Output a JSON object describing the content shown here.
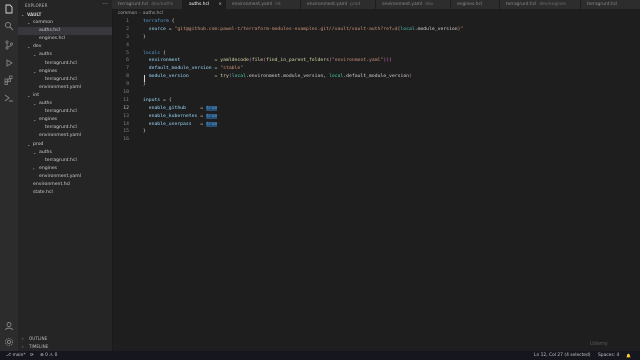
{
  "sidebar": {
    "title": "EXPLORER",
    "more": "···",
    "tree": [
      {
        "label": "VAULT",
        "indent": 0,
        "chevron": "⌄",
        "bold": true
      },
      {
        "label": "common",
        "indent": 1,
        "chevron": "⌄"
      },
      {
        "label": "auths.hcl",
        "indent": 2,
        "chevron": "",
        "selected": true
      },
      {
        "label": "engines.hcl",
        "indent": 2,
        "chevron": ""
      },
      {
        "label": "dev",
        "indent": 1,
        "chevron": "⌄"
      },
      {
        "label": "auths",
        "indent": 2,
        "chevron": "⌄"
      },
      {
        "label": "terragrunt.hcl",
        "indent": 3,
        "chevron": ""
      },
      {
        "label": "engines",
        "indent": 2,
        "chevron": "⌄"
      },
      {
        "label": "terragrunt.hcl",
        "indent": 3,
        "chevron": ""
      },
      {
        "label": "environment.yaml",
        "indent": 2,
        "chevron": ""
      },
      {
        "label": "int",
        "indent": 1,
        "chevron": "⌄"
      },
      {
        "label": "auths",
        "indent": 2,
        "chevron": "⌄"
      },
      {
        "label": "terragrunt.hcl",
        "indent": 3,
        "chevron": ""
      },
      {
        "label": "engines",
        "indent": 2,
        "chevron": "⌄"
      },
      {
        "label": "terragrunt.hcl",
        "indent": 3,
        "chevron": ""
      },
      {
        "label": "environment.yaml",
        "indent": 2,
        "chevron": ""
      },
      {
        "label": "prod",
        "indent": 1,
        "chevron": "⌄"
      },
      {
        "label": "auths",
        "indent": 2,
        "chevron": "⌄"
      },
      {
        "label": "terragrunt.hcl",
        "indent": 3,
        "chevron": ""
      },
      {
        "label": "engines",
        "indent": 2,
        "chevron": "›"
      },
      {
        "label": "environment.yaml",
        "indent": 2,
        "chevron": ""
      },
      {
        "label": "environment.hcl",
        "indent": 1,
        "chevron": ""
      },
      {
        "label": "state.hcl",
        "indent": 1,
        "chevron": ""
      }
    ],
    "outline": "OUTLINE",
    "timeline": "TIMELINE"
  },
  "tabs": [
    {
      "name": "terragrunt.hcl",
      "path": "dev/auths",
      "active": false
    },
    {
      "name": "auths.hcl",
      "path": "",
      "active": true
    },
    {
      "name": "environment.yaml",
      "path": "int",
      "active": false
    },
    {
      "name": "environment.yaml",
      "path": "prod",
      "active": false
    },
    {
      "name": "environment.yaml",
      "path": "dev",
      "active": false
    },
    {
      "name": "engines.hcl",
      "path": "",
      "active": false
    },
    {
      "name": "terragrunt.hcl",
      "path": "dev/engines",
      "active": false
    },
    {
      "name": "terragrunt.hcl",
      "path": "",
      "active": false
    }
  ],
  "tab_actions": "⊟ ···",
  "breadcrumb": {
    "folder": "common",
    "sep": "›",
    "file": "auths.hcl"
  },
  "code_lines": [
    {
      "n": "1",
      "parts": [
        {
          "t": "terraform ",
          "c": "k"
        },
        {
          "t": "{",
          "c": ""
        }
      ]
    },
    {
      "n": "2",
      "parts": [
        {
          "t": "  source ",
          "c": "a"
        },
        {
          "t": "= ",
          "c": ""
        },
        {
          "t": "\"git@github.com:pawel-t/terraform-modules-examples.git//vault/vault-auth?ref=${",
          "c": "s"
        },
        {
          "t": "local",
          "c": "v"
        },
        {
          "t": ".module_version",
          "c": ""
        },
        {
          "t": "}\"",
          "c": "s"
        }
      ]
    },
    {
      "n": "3",
      "parts": [
        {
          "t": "}",
          "c": ""
        }
      ]
    },
    {
      "n": "4",
      "parts": []
    },
    {
      "n": "5",
      "parts": [
        {
          "t": "locals ",
          "c": "k"
        },
        {
          "t": "{",
          "c": ""
        }
      ]
    },
    {
      "n": "6",
      "parts": [
        {
          "t": "  environment            ",
          "c": "a"
        },
        {
          "t": "= ",
          "c": ""
        },
        {
          "t": "yamldecode",
          "c": "f"
        },
        {
          "t": "(",
          "c": "p"
        },
        {
          "t": "file",
          "c": "f"
        },
        {
          "t": "(",
          "c": "p"
        },
        {
          "t": "find_in_parent_folders",
          "c": "f"
        },
        {
          "t": "(",
          "c": "p"
        },
        {
          "t": "\"environment.yaml\"",
          "c": "s"
        },
        {
          "t": ")))",
          "c": "p"
        }
      ]
    },
    {
      "n": "7",
      "parts": [
        {
          "t": "  default_module_version ",
          "c": "a"
        },
        {
          "t": "= ",
          "c": ""
        },
        {
          "t": "\"stable\"",
          "c": "s"
        }
      ]
    },
    {
      "n": "8",
      "parts": [
        {
          "t": "  module_version         ",
          "c": "a"
        },
        {
          "t": "= ",
          "c": ""
        },
        {
          "t": "try",
          "c": "f"
        },
        {
          "t": "(",
          "c": "p"
        },
        {
          "t": "local",
          "c": "v"
        },
        {
          "t": ".environment.module_version, ",
          "c": ""
        },
        {
          "t": "local",
          "c": "v"
        },
        {
          "t": ".default_module_version",
          "c": ""
        },
        {
          "t": ")",
          "c": "p"
        }
      ]
    },
    {
      "n": "9",
      "parts": [
        {
          "t": "}",
          "c": ""
        }
      ]
    },
    {
      "n": "10",
      "parts": []
    },
    {
      "n": "11",
      "parts": [
        {
          "t": "inputs ",
          "c": "a"
        },
        {
          "t": "= {",
          "c": ""
        }
      ]
    },
    {
      "n": "12",
      "current": true,
      "parts": [
        {
          "t": "  enable_github     ",
          "c": "a"
        },
        {
          "t": "= ",
          "c": ""
        },
        {
          "t": "true",
          "c": "hl"
        }
      ]
    },
    {
      "n": "13",
      "parts": [
        {
          "t": "  enable_kubernetes ",
          "c": "a"
        },
        {
          "t": "= ",
          "c": ""
        },
        {
          "t": "true",
          "c": "hl"
        }
      ]
    },
    {
      "n": "14",
      "parts": [
        {
          "t": "  enable_userpass   ",
          "c": "a"
        },
        {
          "t": "= ",
          "c": ""
        },
        {
          "t": "true",
          "c": "hl"
        }
      ]
    },
    {
      "n": "15",
      "parts": [
        {
          "t": "}",
          "c": ""
        }
      ]
    },
    {
      "n": "16",
      "parts": []
    }
  ],
  "status": {
    "branch": "⎇ main*",
    "sync": "⟳",
    "problems": "⊗ 0 ⚠ 0",
    "position": "Ln 12, Col 27 (4 selected)",
    "spaces": "Spaces: 4",
    "bell": "🔔"
  },
  "watermark": "Udemy",
  "colors": {
    "editor_bg": "#1e1e1e",
    "sidebar_bg": "#252526",
    "activity_bg": "#2c2c2c",
    "selection": "#264f78",
    "keyword": "#569cd6",
    "string": "#ce9178"
  }
}
